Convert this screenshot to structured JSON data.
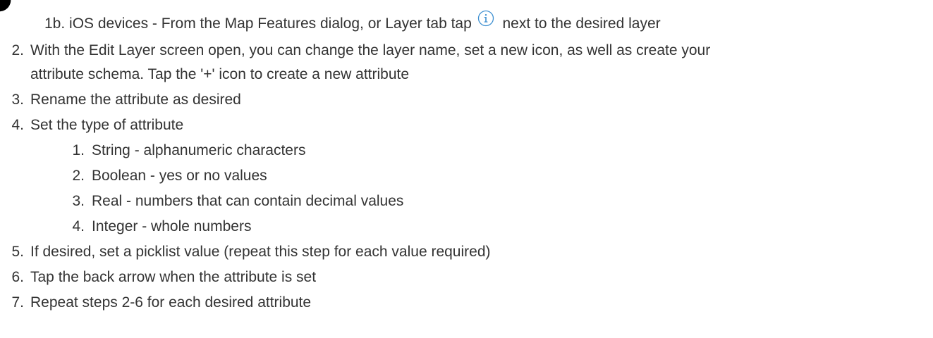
{
  "items": [
    {
      "num": "",
      "text_before": "1b. iOS devices - From the Map Features dialog, or Layer tab tap",
      "icon": "info-circle-icon",
      "text_after": "next to the desired layer"
    },
    {
      "num": "2.",
      "text": "With the Edit Layer screen open, you can change the layer name, set a new icon, as well as create your"
    },
    {
      "num": "",
      "text": "attribute schema.  Tap the '+' icon to create a new attribute"
    },
    {
      "num": "3.",
      "text": "Rename the attribute as desired"
    },
    {
      "num": "4.",
      "text": "Set the type of attribute"
    },
    {
      "num": "1.",
      "text": "String - alphanumeric characters"
    },
    {
      "num": "2.",
      "text": "Boolean - yes or no values"
    },
    {
      "num": "3.",
      "text": "Real - numbers that can contain decimal values"
    },
    {
      "num": "4.",
      "text": "Integer - whole numbers"
    },
    {
      "num": "5.",
      "text": "If desired, set a picklist value (repeat this step for each value required)"
    },
    {
      "num": "6.",
      "text": "Tap the back arrow when the attribute is set"
    },
    {
      "num": "7.",
      "text": "Repeat steps 2-6 for each desired attribute"
    }
  ],
  "colors": {
    "text": "#333333",
    "icon": "#3d8fd1"
  }
}
